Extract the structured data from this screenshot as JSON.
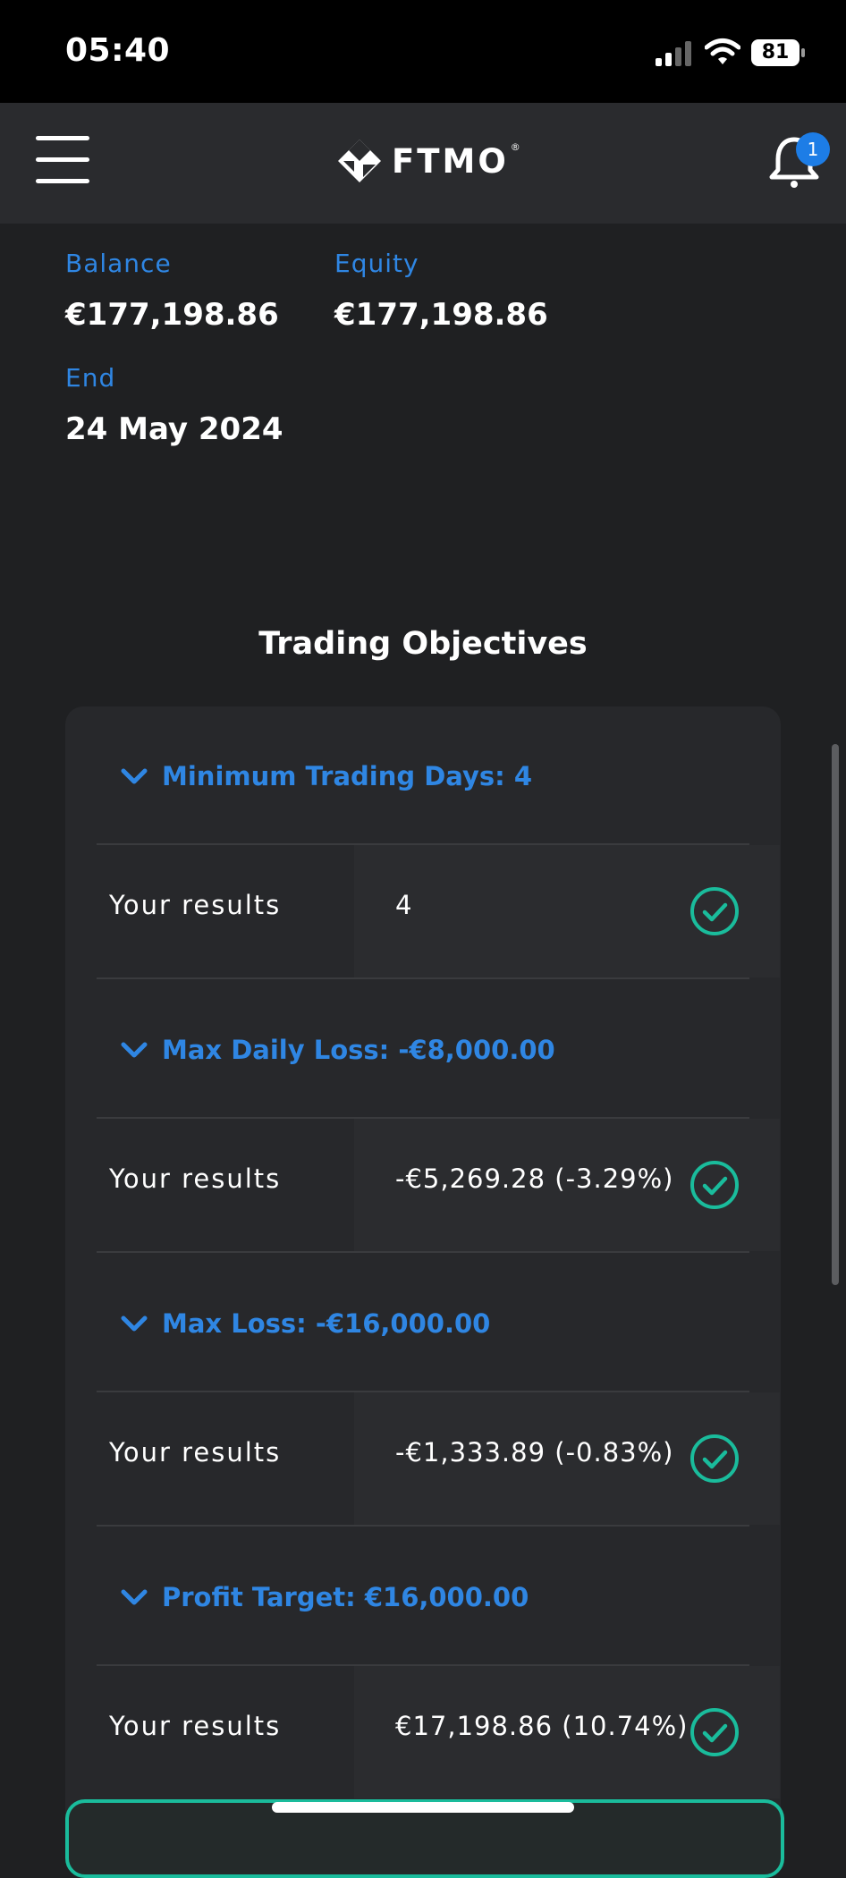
{
  "status_bar": {
    "time": "05:40",
    "battery": "81"
  },
  "header": {
    "logo_text": "FTMO",
    "logo_reg": "®",
    "notification_count": "1"
  },
  "account": {
    "balance_label": "Balance",
    "balance_value": "€177,198.86",
    "equity_label": "Equity",
    "equity_value": "€177,198.86",
    "end_label": "End",
    "end_value": "24 May 2024"
  },
  "objectives": {
    "title": "Trading Objectives",
    "items": [
      {
        "heading": "Minimum Trading Days: 4",
        "result_label": "Your results",
        "result_value": "4",
        "passed": true
      },
      {
        "heading": "Max Daily Loss: -€8,000.00",
        "result_label": "Your results",
        "result_value": "-€5,269.28 (-3.29%)",
        "passed": true
      },
      {
        "heading": "Max Loss: -€16,000.00",
        "result_label": "Your results",
        "result_value": "-€1,333.89 (-0.83%)",
        "passed": true
      },
      {
        "heading": "Profit Target: €16,000.00",
        "result_label": "Your results",
        "result_value": "€17,198.86 (10.74%)",
        "passed": true
      }
    ]
  },
  "colors": {
    "accent": "#2f86e3",
    "success": "#1abc9c",
    "background": "#1f2022",
    "header": "#2a2b2e"
  }
}
